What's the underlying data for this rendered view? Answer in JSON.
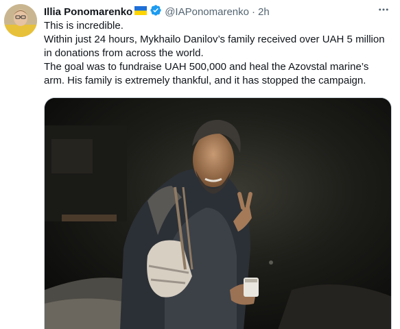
{
  "tweet": {
    "author_name": "Illia Ponomarenko",
    "flag_emoji": "🇺🇦",
    "handle": "@IAPonomarenko",
    "separator": "·",
    "time": "2h",
    "verified": true,
    "lines": [
      "This is incredible.",
      "Within just 24 hours, Mykhailo Danilov’s family received over UAH 5 million in donations from across the world.",
      "The goal was to fundraise UAH 500,000 and heal the Azovstal marine’s arm. His family is extremely thankful, and it has stopped the campaign."
    ],
    "more_icon": "more-horizontal-icon"
  },
  "colors": {
    "text": "#0f1419",
    "secondary": "#536471",
    "verified": "#1d9bf0",
    "border": "#cfd9de"
  }
}
